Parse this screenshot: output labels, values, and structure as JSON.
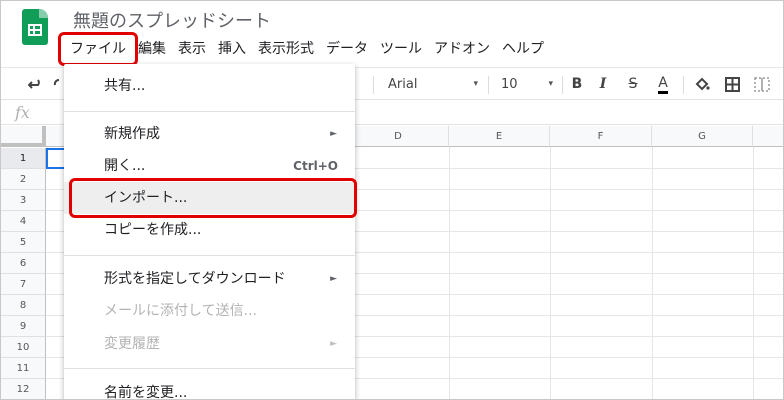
{
  "doc": {
    "title": "無題のスプレッドシート"
  },
  "menubar": {
    "items": [
      "ファイル",
      "編集",
      "表示",
      "挿入",
      "表示形式",
      "データ",
      "ツール",
      "アドオン",
      "ヘルプ"
    ]
  },
  "toolbar": {
    "font": "Arial",
    "font_size": "10",
    "bold": "B",
    "strike": "S",
    "text_color": "A",
    "caret": "▾"
  },
  "formula_bar": {
    "fx": "fx"
  },
  "columns": [
    "D",
    "E",
    "F",
    "G"
  ],
  "rows": [
    "1",
    "2",
    "3",
    "4",
    "5",
    "6",
    "7",
    "8",
    "9",
    "10",
    "11",
    "12"
  ],
  "file_menu": {
    "items": [
      {
        "label": "共有..."
      },
      {
        "label": "新規作成",
        "submenu_arrow": "►"
      },
      {
        "label": "開く...",
        "shortcut": "Ctrl+O"
      },
      {
        "label": "インポート..."
      },
      {
        "label": "コピーを作成..."
      },
      {
        "label": "形式を指定してダウンロード",
        "submenu_arrow": "►"
      },
      {
        "label": "メールに添付して送信..."
      },
      {
        "label": "変更履歴",
        "submenu_arrow": "►"
      },
      {
        "label": "名前を変更..."
      }
    ]
  },
  "colors": {
    "highlight": "#e00000",
    "sheets_green": "#0f9d58",
    "selection": "#1a73e8"
  }
}
